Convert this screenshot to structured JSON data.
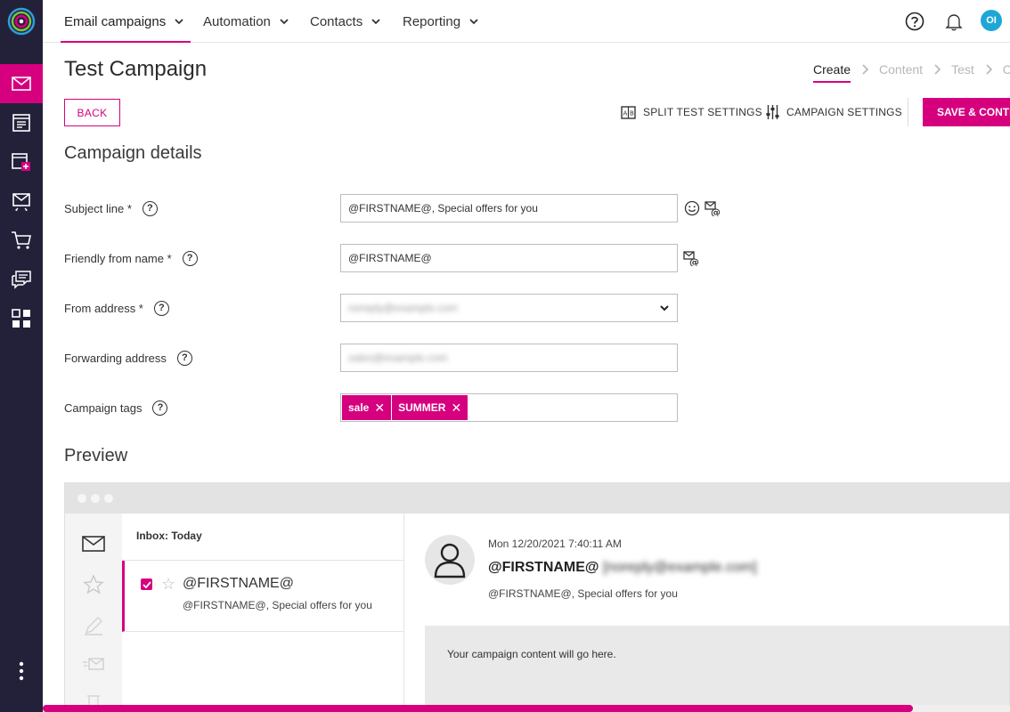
{
  "nav": {
    "tabs": [
      {
        "label": "Email campaigns",
        "active": true
      },
      {
        "label": "Automation"
      },
      {
        "label": "Contacts"
      },
      {
        "label": "Reporting"
      }
    ],
    "avatar_initials": "OI"
  },
  "rail": {
    "icons": [
      "logo-icon",
      "email-icon",
      "newsletter-icon",
      "templates-icon",
      "transactional-email-icon",
      "cart-icon",
      "chat-icon",
      "apps-icon",
      "more-icon"
    ],
    "active": "email-icon"
  },
  "page": {
    "title": "Test Campaign",
    "steps": [
      "Create",
      "Content",
      "Test",
      "C"
    ],
    "active_step": "Create"
  },
  "toolbar": {
    "back_label": "BACK",
    "split_test_label": "SPLIT TEST SETTINGS",
    "campaign_settings_label": "CAMPAIGN SETTINGS",
    "save_label": "SAVE & CONTINUE"
  },
  "details": {
    "title": "Campaign details",
    "subject": {
      "label": "Subject line *",
      "value": "@FIRSTNAME@, Special offers for you"
    },
    "friendly_from": {
      "label": "Friendly from name *",
      "value": "@FIRSTNAME@"
    },
    "from_address": {
      "label": "From address *",
      "value": "noreply@example.com"
    },
    "forwarding": {
      "label": "Forwarding address",
      "value": "sales@example.com"
    },
    "tags": {
      "label": "Campaign tags",
      "items": [
        "sale",
        "SUMMER"
      ]
    },
    "help_glyph": "?"
  },
  "preview": {
    "title": "Preview",
    "inbox_header": "Inbox: Today",
    "message_from": "@FIRSTNAME@",
    "message_snippet": "@FIRSTNAME@, Special offers for you",
    "date": "Mon 12/20/2021 7:40:11 AM",
    "sender_name": "@FIRSTNAME@",
    "sender_address": "[noreply@example.com]",
    "subject": "@FIRSTNAME@, Special offers for you",
    "body_placeholder": "Your campaign content will go here."
  },
  "colors": {
    "accent": "#d6007f",
    "rail": "#23213a",
    "avatar": "#1ea7d6"
  }
}
